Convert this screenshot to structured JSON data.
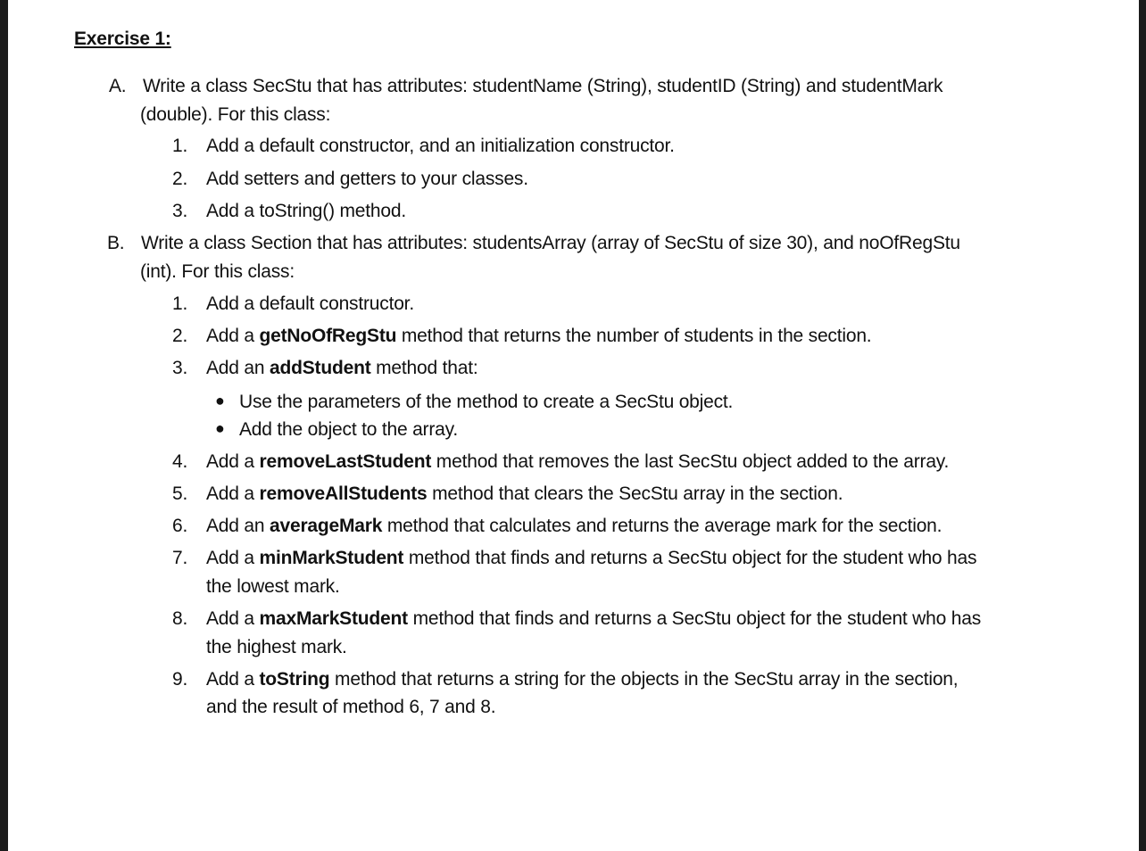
{
  "exercise_title": "Exercise 1:",
  "sectionA": {
    "marker": "A.",
    "line1": "Write a class SecStu that has attributes: studentName (String), studentID (String) and studentMark",
    "line2": "(double). For this class:",
    "items": [
      {
        "num": "1.",
        "text": "Add a default constructor, and an initialization constructor."
      },
      {
        "num": "2.",
        "text": "Add setters and getters to your classes."
      },
      {
        "num": "3.",
        "text": "Add a toString() method."
      }
    ]
  },
  "sectionB": {
    "marker": "B.",
    "line1": "Write a class Section that has attributes: studentsArray (array of SecStu of size 30), and noOfRegStu",
    "line2": "(int). For this class:",
    "items": [
      {
        "num": "1.",
        "pre": "Add a default constructor.",
        "bold": "",
        "post": ""
      },
      {
        "num": "2.",
        "pre": "Add a ",
        "bold": "getNoOfRegStu",
        "post": " method that returns the number of students in the section."
      },
      {
        "num": "3.",
        "pre": "Add an ",
        "bold": "addStudent",
        "post": " method that:"
      },
      {
        "num": "4.",
        "pre": "Add a ",
        "bold": "removeLastStudent",
        "post": " method that removes the last SecStu object added to the array."
      },
      {
        "num": "5.",
        "pre": "Add a ",
        "bold": "removeAllStudents",
        "post": " method that clears the SecStu array in the section."
      },
      {
        "num": "6.",
        "pre": "Add an ",
        "bold": "averageMark",
        "post": " method that calculates and returns the average mark for the section."
      },
      {
        "num": "7.",
        "pre": "Add a ",
        "bold": "minMarkStudent",
        "post": " method that finds and returns a SecStu object for the student who has",
        "cont": "the lowest mark."
      },
      {
        "num": "8.",
        "pre": "Add a ",
        "bold": "maxMarkStudent",
        "post": " method that finds and returns a SecStu object for the student who has",
        "cont": "the highest mark."
      },
      {
        "num": "9.",
        "pre": "Add a ",
        "bold": "toString",
        "post": " method that returns a string for the objects in the SecStu array in the section,",
        "cont": "and the result of method 6, 7 and 8."
      }
    ],
    "bullets": [
      "Use the parameters of the method to create a SecStu object.",
      "Add the object to the array."
    ]
  }
}
